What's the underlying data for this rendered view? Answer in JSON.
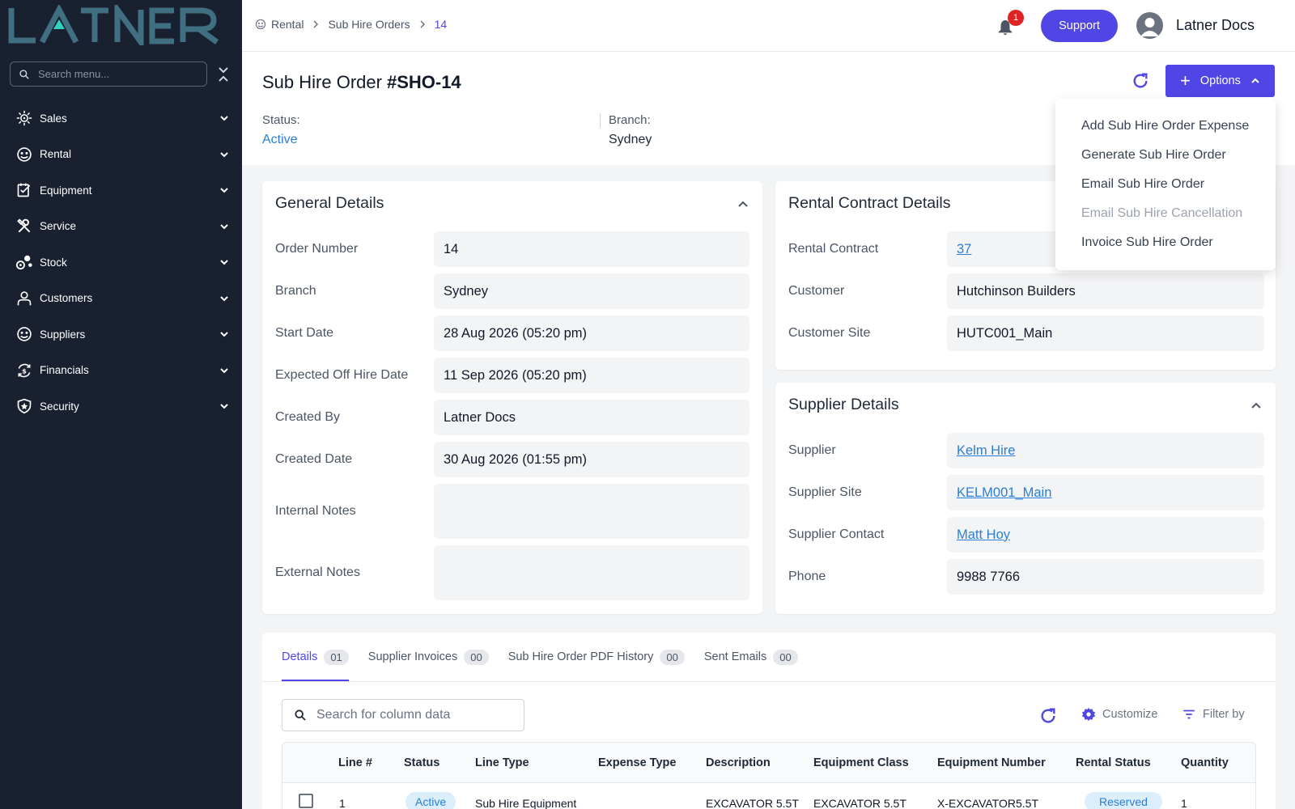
{
  "sidebar": {
    "search_placeholder": "Search menu...",
    "items": [
      {
        "label": "Sales",
        "icon": "sales-icon"
      },
      {
        "label": "Rental",
        "icon": "rental-icon"
      },
      {
        "label": "Equipment",
        "icon": "equipment-icon"
      },
      {
        "label": "Service",
        "icon": "service-icon"
      },
      {
        "label": "Stock",
        "icon": "stock-icon"
      },
      {
        "label": "Customers",
        "icon": "customers-icon"
      },
      {
        "label": "Suppliers",
        "icon": "suppliers-icon"
      },
      {
        "label": "Financials",
        "icon": "financials-icon"
      },
      {
        "label": "Security",
        "icon": "security-icon"
      }
    ]
  },
  "topbar": {
    "breadcrumb": [
      "Rental",
      "Sub Hire Orders",
      "14"
    ],
    "notification_count": "1",
    "support_label": "Support",
    "user_name": "Latner Docs"
  },
  "header": {
    "title": "Sub Hire Order",
    "order_id": "#SHO-14",
    "options_label": "Options",
    "status_label": "Status:",
    "status_value": "Active",
    "branch_label": "Branch:",
    "branch_value": "Sydney"
  },
  "options_menu": [
    {
      "label": "Add Sub Hire Order Expense",
      "enabled": true
    },
    {
      "label": "Generate Sub Hire Order",
      "enabled": true
    },
    {
      "label": "Email Sub Hire Order",
      "enabled": true
    },
    {
      "label": "Email Sub Hire Cancellation",
      "enabled": false
    },
    {
      "label": "Invoice Sub Hire Order",
      "enabled": true
    }
  ],
  "general": {
    "title": "General Details",
    "fields": [
      {
        "label": "Order Number",
        "value": "14"
      },
      {
        "label": "Branch",
        "value": "Sydney"
      },
      {
        "label": "Start Date",
        "value": "28 Aug 2026 (05:20 pm)"
      },
      {
        "label": "Expected Off Hire Date",
        "value": "11 Sep 2026 (05:20 pm)"
      },
      {
        "label": "Created By",
        "value": "Latner Docs"
      },
      {
        "label": "Created Date",
        "value": "30 Aug 2026 (01:55 pm)"
      },
      {
        "label": "Internal Notes",
        "value": ""
      },
      {
        "label": "External Notes",
        "value": ""
      }
    ]
  },
  "rental_contract": {
    "title": "Rental Contract Details",
    "fields": [
      {
        "label": "Rental Contract",
        "value": "37"
      },
      {
        "label": "Customer",
        "value": "Hutchinson Builders"
      },
      {
        "label": "Customer Site",
        "value": "HUTC001_Main"
      }
    ]
  },
  "supplier": {
    "title": "Supplier Details",
    "fields": [
      {
        "label": "Supplier",
        "value": "Kelm Hire"
      },
      {
        "label": "Supplier Site",
        "value": "KELM001_Main"
      },
      {
        "label": "Supplier Contact",
        "value": "Matt Hoy"
      },
      {
        "label": "Phone",
        "value": "9988 7766"
      }
    ]
  },
  "tabs": [
    {
      "label": "Details",
      "count": "01"
    },
    {
      "label": "Supplier Invoices",
      "count": "00"
    },
    {
      "label": "Sub Hire Order PDF History",
      "count": "00"
    },
    {
      "label": "Sent Emails",
      "count": "00"
    }
  ],
  "table": {
    "search_placeholder": "Search for column data",
    "customize_label": "Customize",
    "filter_label": "Filter by",
    "columns": [
      "Line #",
      "Status",
      "Line Type",
      "Expense Type",
      "Description",
      "Equipment Class",
      "Equipment Number",
      "Rental Status",
      "Quantity"
    ],
    "rows": [
      {
        "line": "1",
        "status": "Active",
        "line_type": "Sub Hire Equipment",
        "expense_type": "",
        "description": "EXCAVATOR 5.5T",
        "equipment_class": "EXCAVATOR 5.5T",
        "equipment_number": "X-EXCAVATOR5.5T",
        "rental_status": "Reserved",
        "quantity": "1"
      }
    ]
  },
  "colors": {
    "primary": "#4f46e5",
    "sidebar": "#19202f",
    "link": "#2a7fd4",
    "badge": "#e02424",
    "logo": "#3f6f80"
  }
}
